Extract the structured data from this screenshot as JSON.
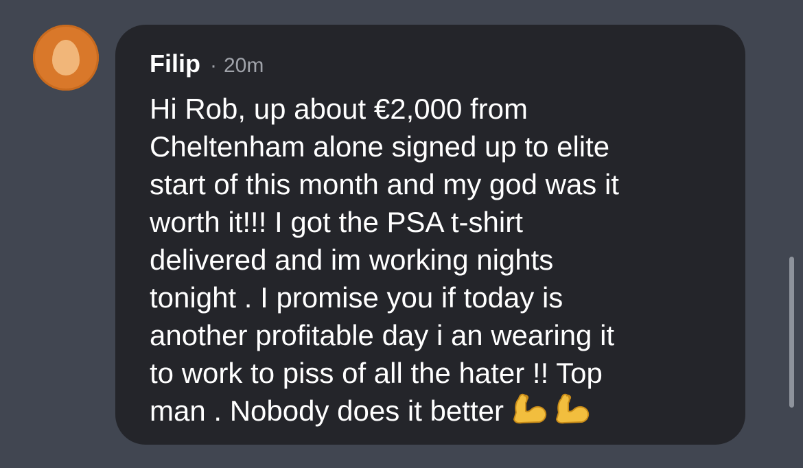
{
  "post": {
    "author": "Filip",
    "separator": "·",
    "time": "20m",
    "avatar_icon": "egg-avatar-icon",
    "message_lines": [
      "Hi Rob, up about €2,000 from",
      "Cheltenham alone signed up to elite",
      "start of this month and my god was it",
      "worth it!!! I got the PSA t-shirt",
      "delivered and im working nights",
      "tonight . I promise you if today is",
      "another profitable day i an wearing it",
      "to work to piss of all the hater !! Top",
      "man . Nobody does it better"
    ],
    "emojis": [
      "flexed-biceps-icon",
      "flexed-biceps-icon"
    ]
  },
  "colors": {
    "background": "#414651",
    "bubble": "#24252a",
    "avatar": "#d9782a",
    "text": "#ffffff",
    "muted": "#a0a3aa"
  }
}
